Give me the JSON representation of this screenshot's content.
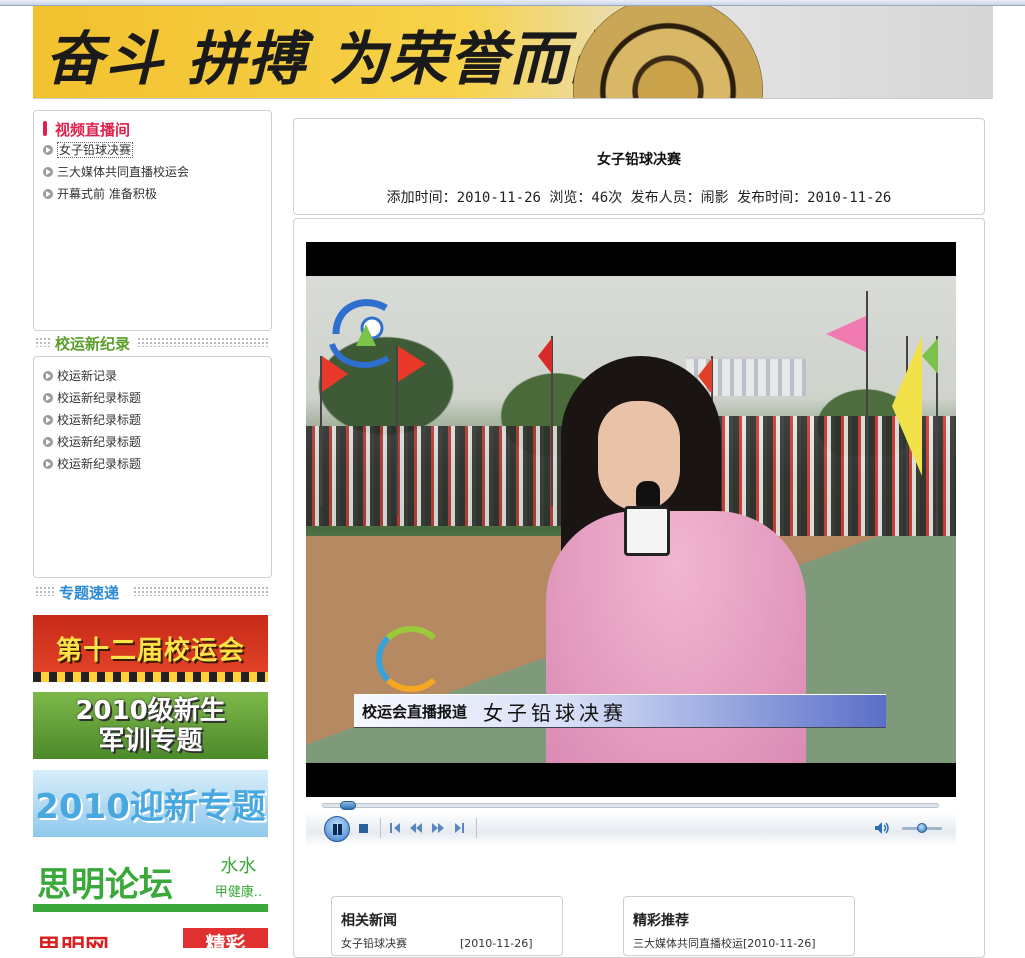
{
  "banner": {
    "slogan": "奋斗 拼搏 为荣誉而战!"
  },
  "video_panel": {
    "title": "视频直播间",
    "items": [
      {
        "label": "女子铅球决赛",
        "active": true
      },
      {
        "label": "三大媒体共同直播校运会",
        "active": false
      },
      {
        "label": "开幕式前 准备积极",
        "active": false
      }
    ]
  },
  "records_section": {
    "title": "校运新纪录",
    "items": [
      {
        "label": "校运新记录"
      },
      {
        "label": "校运新纪录标题"
      },
      {
        "label": "校运新纪录标题"
      },
      {
        "label": "校运新纪录标题"
      },
      {
        "label": "校运新纪录标题"
      }
    ]
  },
  "topics_section": {
    "title": "专题速递",
    "promos": [
      {
        "text": "第十二届校运会"
      },
      {
        "line1": "2010级新生",
        "line2": "军训专题"
      },
      {
        "text": "2010迎新专题"
      },
      {
        "text": "思明论坛",
        "side_line1": "水水",
        "side_line2": "甲健康.."
      },
      {
        "text": "思明网",
        "side": "精彩"
      }
    ]
  },
  "article": {
    "title": "女子铅球决赛",
    "meta": "添加时间：2010-11-26 浏览：46次 发布人员：闹影 发布时间：2010-11-26"
  },
  "player": {
    "lower_third_tag": "校运会直播报道",
    "lower_third_caption": "女子铅球决赛",
    "progress": 0.03,
    "volume": 0.5,
    "icons": {
      "pause": "pause-icon",
      "stop": "stop-icon",
      "prev": "skip-previous-icon",
      "rewind": "rewind-icon",
      "forward": "fast-forward-icon",
      "next": "skip-next-icon",
      "volume": "speaker-icon"
    }
  },
  "related": {
    "title": "相关新闻",
    "row_title": "女子铅球决赛",
    "row_date": "[2010-11-26]"
  },
  "recommend": {
    "title": "精彩推荐",
    "row_text": "三大媒体共同直播校运[2010-11-26]"
  },
  "colors": {
    "accent_red": "#e0204c",
    "section_green": "#5a9e2a",
    "section_blue": "#2a8ad6",
    "player_blue": "#2f6fb0"
  }
}
